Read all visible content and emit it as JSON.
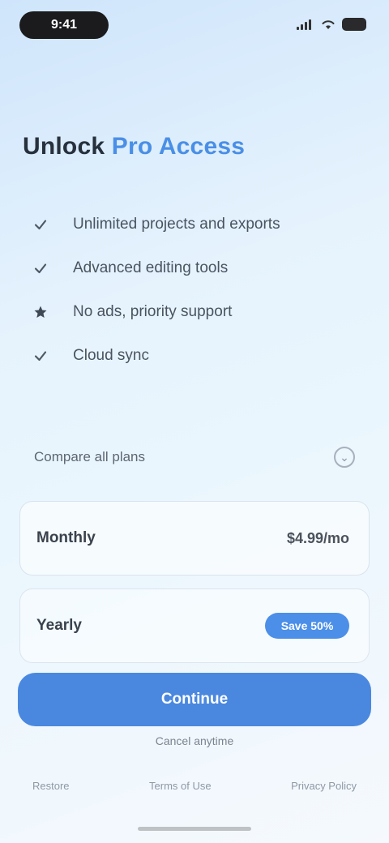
{
  "status_bar": {
    "time": "9:41"
  },
  "headline": {
    "dark": "Unlock",
    "accent": "Pro Access"
  },
  "features": [
    {
      "icon": "check-icon",
      "label": "Unlimited projects and exports"
    },
    {
      "icon": "check-icon",
      "label": "Advanced editing tools"
    },
    {
      "icon": "star-icon",
      "label": "No ads, priority support"
    },
    {
      "icon": "check-icon",
      "label": "Cloud sync"
    }
  ],
  "options": {
    "toggle_label": "Compare all plans"
  },
  "plans": {
    "monthly": {
      "name": "Monthly",
      "price": "$4.99/mo"
    },
    "yearly": {
      "name": "Yearly",
      "badge": "Save 50%"
    }
  },
  "cta": {
    "label": "Continue"
  },
  "fine_print": "Cancel anytime",
  "footer": {
    "links": [
      "Restore",
      "Terms of Use",
      "Privacy Policy"
    ]
  },
  "colors": {
    "accent": "#4a8fe6",
    "cta": "#4a88e0"
  }
}
